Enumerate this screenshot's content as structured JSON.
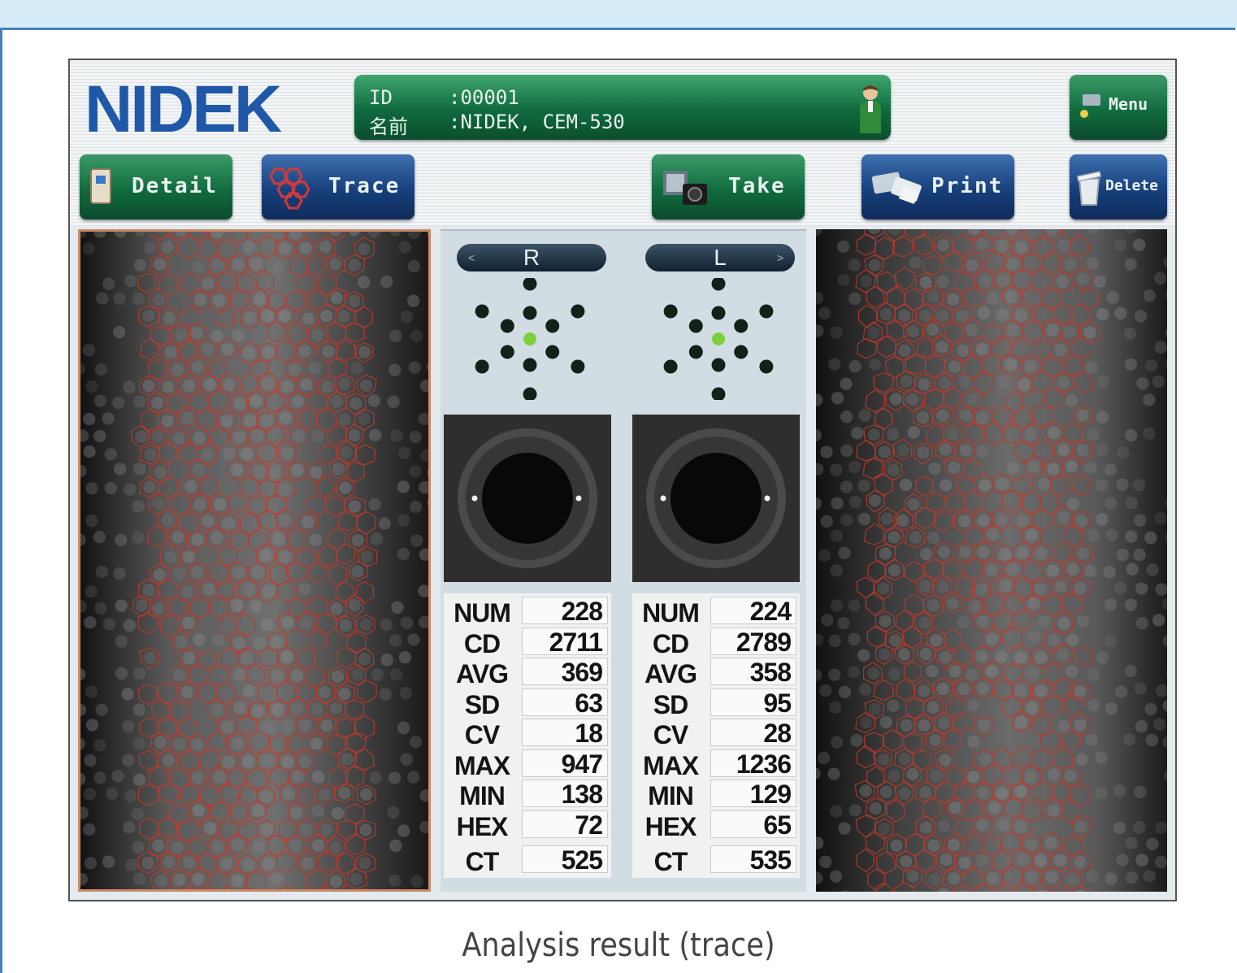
{
  "brand": {
    "logo": "NIDEK"
  },
  "patient": {
    "id_label": "ID",
    "id_value": ":00001",
    "name_label": "名前",
    "name_value": ":NIDEK, CEM-530"
  },
  "toolbar": {
    "menu": "Menu",
    "detail": "Detail",
    "trace": "Trace",
    "take": "Take",
    "print": "Print",
    "delete": "Delete"
  },
  "eyes": {
    "right": {
      "label": "R",
      "stats": [
        {
          "key": "NUM",
          "value": "228"
        },
        {
          "key": "CD",
          "value": "2711"
        },
        {
          "key": "AVG",
          "value": "369"
        },
        {
          "key": "SD",
          "value": "63"
        },
        {
          "key": "CV",
          "value": "18"
        },
        {
          "key": "MAX",
          "value": "947"
        },
        {
          "key": "MIN",
          "value": "138"
        },
        {
          "key": "HEX",
          "value": "72"
        },
        {
          "key": "CT",
          "value": "525"
        }
      ]
    },
    "left": {
      "label": "L",
      "stats": [
        {
          "key": "NUM",
          "value": "224"
        },
        {
          "key": "CD",
          "value": "2789"
        },
        {
          "key": "AVG",
          "value": "358"
        },
        {
          "key": "SD",
          "value": "95"
        },
        {
          "key": "CV",
          "value": "28"
        },
        {
          "key": "MAX",
          "value": "1236"
        },
        {
          "key": "MIN",
          "value": "129"
        },
        {
          "key": "HEX",
          "value": "65"
        },
        {
          "key": "CT",
          "value": "535"
        }
      ]
    }
  },
  "caption": "Analysis result (trace)",
  "colors": {
    "brand_blue": "#1f58a8",
    "button_green": "#116b3f",
    "button_blue": "#173f7c",
    "trace_red": "#c0392b",
    "fixation_active": "#7ccf3c"
  }
}
